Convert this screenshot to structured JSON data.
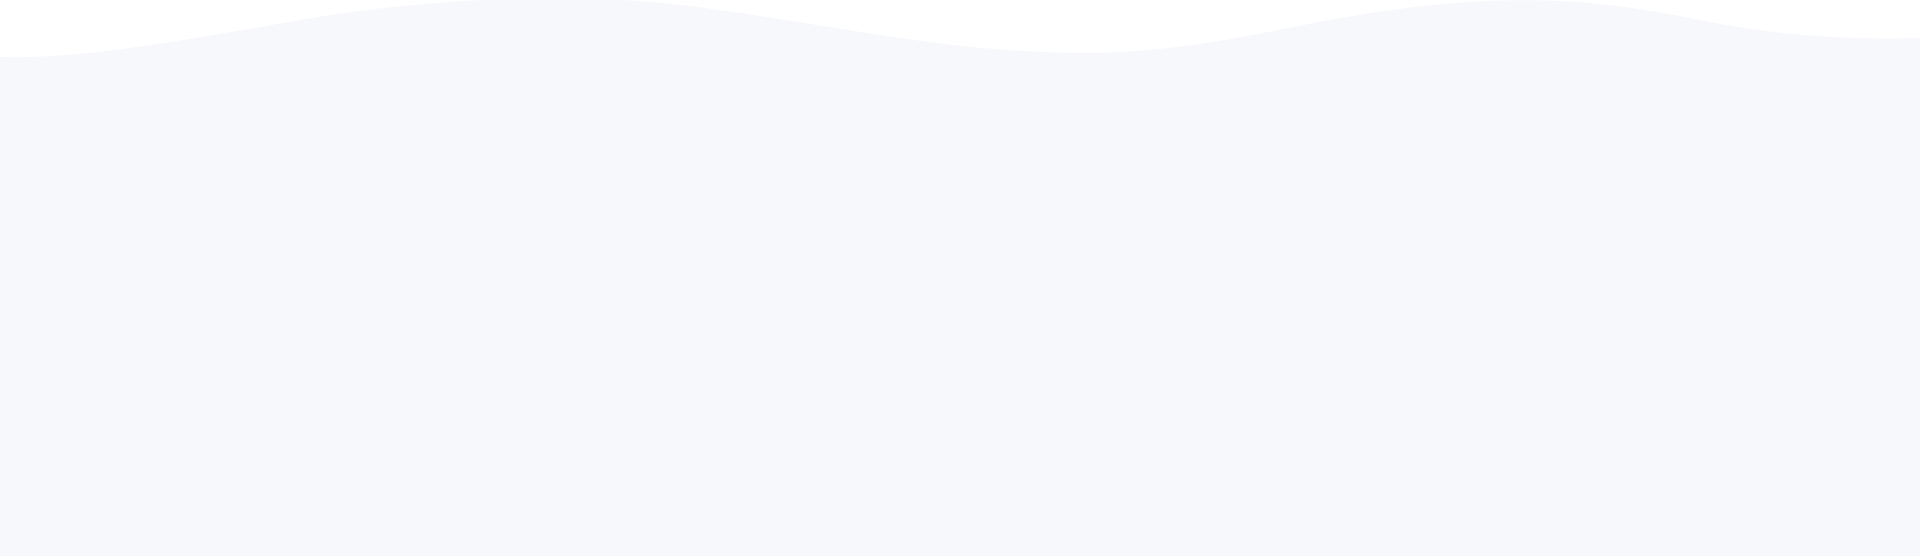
{
  "colors": {
    "background": "#ffffff",
    "wave_fill": "#f7f8fc"
  }
}
